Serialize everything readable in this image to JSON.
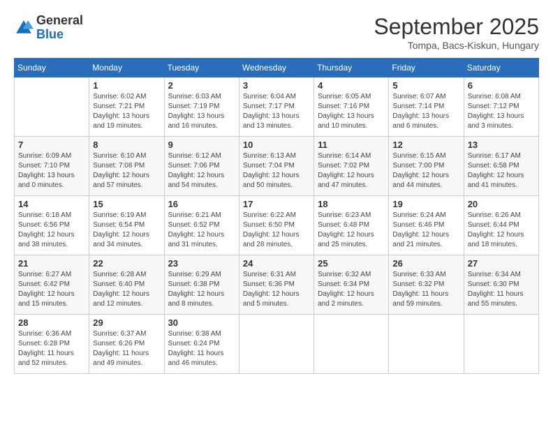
{
  "header": {
    "logo_general": "General",
    "logo_blue": "Blue",
    "month": "September 2025",
    "location": "Tompa, Bacs-Kiskun, Hungary"
  },
  "weekdays": [
    "Sunday",
    "Monday",
    "Tuesday",
    "Wednesday",
    "Thursday",
    "Friday",
    "Saturday"
  ],
  "weeks": [
    [
      {
        "day": "",
        "info": ""
      },
      {
        "day": "1",
        "info": "Sunrise: 6:02 AM\nSunset: 7:21 PM\nDaylight: 13 hours\nand 19 minutes."
      },
      {
        "day": "2",
        "info": "Sunrise: 6:03 AM\nSunset: 7:19 PM\nDaylight: 13 hours\nand 16 minutes."
      },
      {
        "day": "3",
        "info": "Sunrise: 6:04 AM\nSunset: 7:17 PM\nDaylight: 13 hours\nand 13 minutes."
      },
      {
        "day": "4",
        "info": "Sunrise: 6:05 AM\nSunset: 7:16 PM\nDaylight: 13 hours\nand 10 minutes."
      },
      {
        "day": "5",
        "info": "Sunrise: 6:07 AM\nSunset: 7:14 PM\nDaylight: 13 hours\nand 6 minutes."
      },
      {
        "day": "6",
        "info": "Sunrise: 6:08 AM\nSunset: 7:12 PM\nDaylight: 13 hours\nand 3 minutes."
      }
    ],
    [
      {
        "day": "7",
        "info": "Sunrise: 6:09 AM\nSunset: 7:10 PM\nDaylight: 13 hours\nand 0 minutes."
      },
      {
        "day": "8",
        "info": "Sunrise: 6:10 AM\nSunset: 7:08 PM\nDaylight: 12 hours\nand 57 minutes."
      },
      {
        "day": "9",
        "info": "Sunrise: 6:12 AM\nSunset: 7:06 PM\nDaylight: 12 hours\nand 54 minutes."
      },
      {
        "day": "10",
        "info": "Sunrise: 6:13 AM\nSunset: 7:04 PM\nDaylight: 12 hours\nand 50 minutes."
      },
      {
        "day": "11",
        "info": "Sunrise: 6:14 AM\nSunset: 7:02 PM\nDaylight: 12 hours\nand 47 minutes."
      },
      {
        "day": "12",
        "info": "Sunrise: 6:15 AM\nSunset: 7:00 PM\nDaylight: 12 hours\nand 44 minutes."
      },
      {
        "day": "13",
        "info": "Sunrise: 6:17 AM\nSunset: 6:58 PM\nDaylight: 12 hours\nand 41 minutes."
      }
    ],
    [
      {
        "day": "14",
        "info": "Sunrise: 6:18 AM\nSunset: 6:56 PM\nDaylight: 12 hours\nand 38 minutes."
      },
      {
        "day": "15",
        "info": "Sunrise: 6:19 AM\nSunset: 6:54 PM\nDaylight: 12 hours\nand 34 minutes."
      },
      {
        "day": "16",
        "info": "Sunrise: 6:21 AM\nSunset: 6:52 PM\nDaylight: 12 hours\nand 31 minutes."
      },
      {
        "day": "17",
        "info": "Sunrise: 6:22 AM\nSunset: 6:50 PM\nDaylight: 12 hours\nand 28 minutes."
      },
      {
        "day": "18",
        "info": "Sunrise: 6:23 AM\nSunset: 6:48 PM\nDaylight: 12 hours\nand 25 minutes."
      },
      {
        "day": "19",
        "info": "Sunrise: 6:24 AM\nSunset: 6:46 PM\nDaylight: 12 hours\nand 21 minutes."
      },
      {
        "day": "20",
        "info": "Sunrise: 6:26 AM\nSunset: 6:44 PM\nDaylight: 12 hours\nand 18 minutes."
      }
    ],
    [
      {
        "day": "21",
        "info": "Sunrise: 6:27 AM\nSunset: 6:42 PM\nDaylight: 12 hours\nand 15 minutes."
      },
      {
        "day": "22",
        "info": "Sunrise: 6:28 AM\nSunset: 6:40 PM\nDaylight: 12 hours\nand 12 minutes."
      },
      {
        "day": "23",
        "info": "Sunrise: 6:29 AM\nSunset: 6:38 PM\nDaylight: 12 hours\nand 8 minutes."
      },
      {
        "day": "24",
        "info": "Sunrise: 6:31 AM\nSunset: 6:36 PM\nDaylight: 12 hours\nand 5 minutes."
      },
      {
        "day": "25",
        "info": "Sunrise: 6:32 AM\nSunset: 6:34 PM\nDaylight: 12 hours\nand 2 minutes."
      },
      {
        "day": "26",
        "info": "Sunrise: 6:33 AM\nSunset: 6:32 PM\nDaylight: 11 hours\nand 59 minutes."
      },
      {
        "day": "27",
        "info": "Sunrise: 6:34 AM\nSunset: 6:30 PM\nDaylight: 11 hours\nand 55 minutes."
      }
    ],
    [
      {
        "day": "28",
        "info": "Sunrise: 6:36 AM\nSunset: 6:28 PM\nDaylight: 11 hours\nand 52 minutes."
      },
      {
        "day": "29",
        "info": "Sunrise: 6:37 AM\nSunset: 6:26 PM\nDaylight: 11 hours\nand 49 minutes."
      },
      {
        "day": "30",
        "info": "Sunrise: 6:38 AM\nSunset: 6:24 PM\nDaylight: 11 hours\nand 46 minutes."
      },
      {
        "day": "",
        "info": ""
      },
      {
        "day": "",
        "info": ""
      },
      {
        "day": "",
        "info": ""
      },
      {
        "day": "",
        "info": ""
      }
    ]
  ]
}
